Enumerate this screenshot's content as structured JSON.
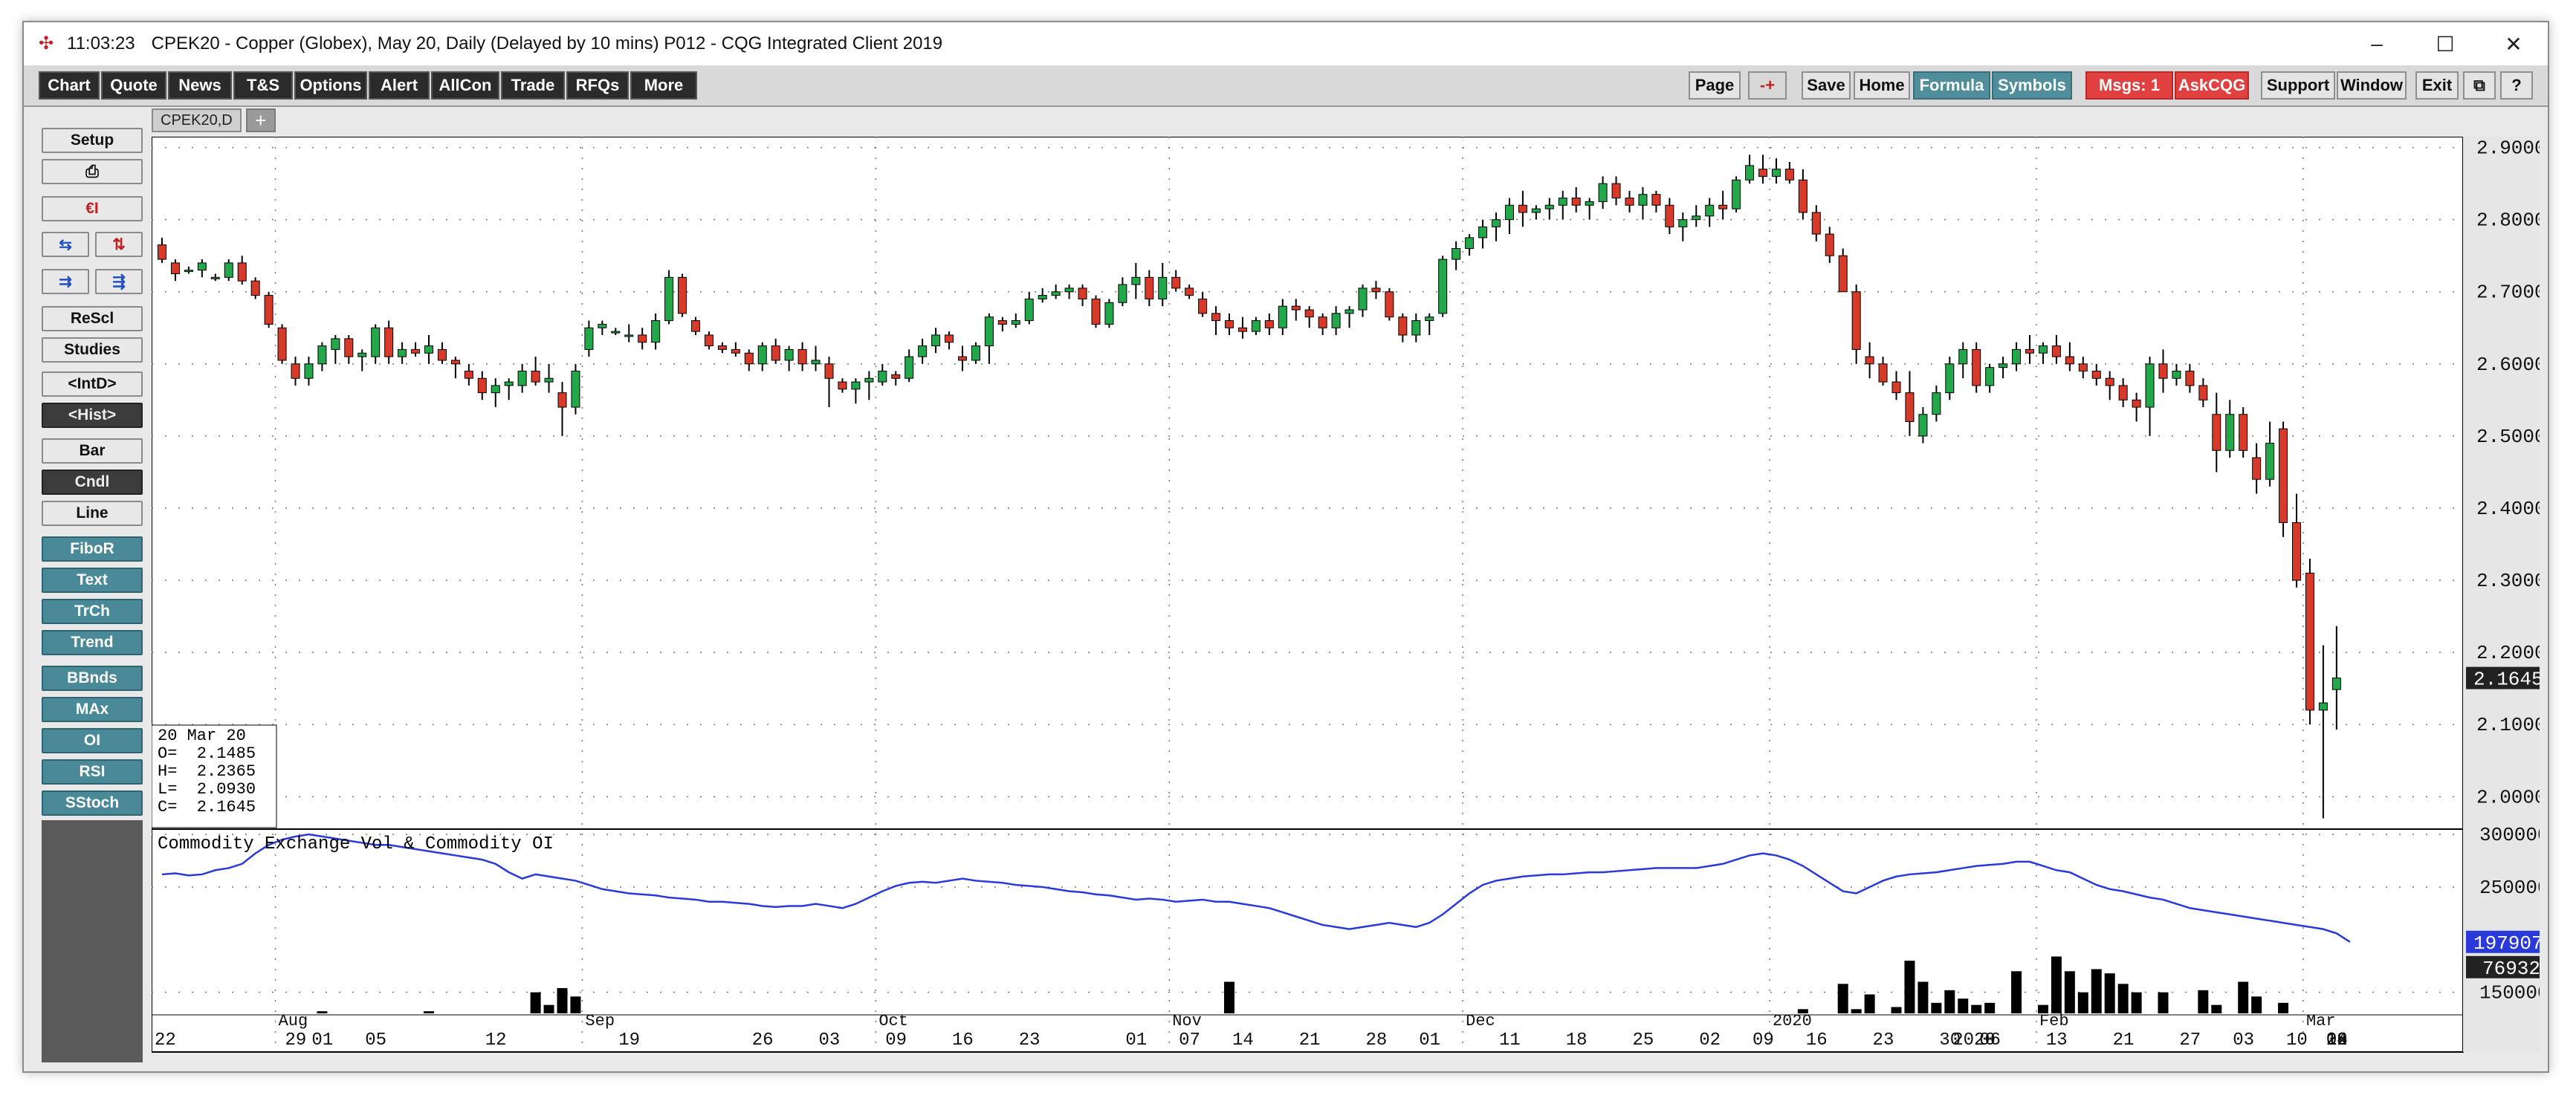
{
  "title_bar": {
    "time": "11:03:23",
    "title": "CPEK20 - Copper (Globex), May 20, Daily (Delayed by 10 mins)   P012 - CQG Integrated Client 2019",
    "minimize": "–",
    "maximize": "☐",
    "close": "✕"
  },
  "menu_left": [
    "Chart",
    "Quote",
    "News",
    "T&S",
    "Options",
    "Alert",
    "AllCon",
    "Trade",
    "RFQs",
    "More"
  ],
  "menu_right": {
    "page": "Page",
    "arrows": "-+",
    "save": "Save",
    "home": "Home",
    "formula": "Formula",
    "symbols": "Symbols",
    "msgs": "Msgs: 1",
    "askcqg": "AskCQG",
    "support": "Support",
    "window": "Window",
    "exit": "Exit",
    "restore": "⧉",
    "help": "?"
  },
  "sidebar": {
    "setup": "Setup",
    "print_icon": "⎙",
    "currency_icon": "€I",
    "rescl": "ReScl",
    "studies": "Studies",
    "intd": "<IntD>",
    "hist": "<Hist>",
    "bar": "Bar",
    "cndl": "Cndl",
    "line": "Line",
    "studies_list": [
      "FiboR",
      "Text",
      "TrCh",
      "Trend",
      "BBnds",
      "MAx",
      "OI",
      "RSI",
      "SStoch"
    ]
  },
  "tab": {
    "label": "CPEK20,D",
    "add": "+"
  },
  "chart_data": {
    "type": "candlestick",
    "symbol": "CPEK20,D",
    "price_axis": {
      "ylim": [
        1.955,
        2.915
      ],
      "ticks": [
        "2.9000",
        "2.8000",
        "2.7000",
        "2.6000",
        "2.5000",
        "2.4000",
        "2.3000",
        "2.2000",
        "2.1000",
        "2.0000"
      ],
      "current": "2.1645"
    },
    "date_labels": [
      "22",
      "29",
      "01",
      "05",
      "12",
      "19",
      "26",
      "03",
      "09",
      "16",
      "23",
      "01",
      "07",
      "14",
      "21",
      "28",
      "01",
      "11",
      "18",
      "25",
      "02",
      "09",
      "16",
      "23",
      "30",
      "2020",
      "06",
      "13",
      "21",
      "27",
      "03",
      "10",
      "18",
      "24",
      "02",
      "09",
      "16"
    ],
    "month_labels": [
      "Aug",
      "Sep",
      "Oct",
      "Nov",
      "Dec",
      "2020",
      "Feb",
      "Mar"
    ],
    "ohlc_readout": {
      "date": "20 Mar 20",
      "open": "O=  2.1485",
      "high": "H=  2.2365",
      "low": "L=  2.0930",
      "close": "C=  2.1645"
    },
    "candles": [
      [
        2.765,
        2.775,
        2.74,
        2.745
      ],
      [
        2.74,
        2.745,
        2.715,
        2.725
      ],
      [
        2.73,
        2.735,
        2.725,
        2.73
      ],
      [
        2.73,
        2.745,
        2.72,
        2.74
      ],
      [
        2.72,
        2.725,
        2.715,
        2.72
      ],
      [
        2.72,
        2.745,
        2.715,
        2.74
      ],
      [
        2.74,
        2.75,
        2.71,
        2.715
      ],
      [
        2.715,
        2.72,
        2.69,
        2.695
      ],
      [
        2.695,
        2.7,
        2.65,
        2.655
      ],
      [
        2.65,
        2.655,
        2.6,
        2.605
      ],
      [
        2.6,
        2.61,
        2.57,
        2.58
      ],
      [
        2.58,
        2.61,
        2.57,
        2.6
      ],
      [
        2.6,
        2.63,
        2.59,
        2.625
      ],
      [
        2.62,
        2.64,
        2.6,
        2.635
      ],
      [
        2.635,
        2.64,
        2.6,
        2.61
      ],
      [
        2.61,
        2.62,
        2.59,
        2.615
      ],
      [
        2.61,
        2.655,
        2.6,
        2.65
      ],
      [
        2.65,
        2.66,
        2.6,
        2.61
      ],
      [
        2.61,
        2.63,
        2.6,
        2.62
      ],
      [
        2.62,
        2.63,
        2.61,
        2.615
      ],
      [
        2.615,
        2.64,
        2.6,
        2.625
      ],
      [
        2.62,
        2.63,
        2.6,
        2.605
      ],
      [
        2.605,
        2.61,
        2.58,
        2.6
      ],
      [
        2.59,
        2.6,
        2.57,
        2.58
      ],
      [
        2.58,
        2.59,
        2.55,
        2.56
      ],
      [
        2.56,
        2.58,
        2.54,
        2.57
      ],
      [
        2.57,
        2.58,
        2.55,
        2.575
      ],
      [
        2.57,
        2.6,
        2.56,
        2.59
      ],
      [
        2.59,
        2.61,
        2.57,
        2.575
      ],
      [
        2.575,
        2.6,
        2.56,
        2.58
      ],
      [
        2.56,
        2.575,
        2.5,
        2.54
      ],
      [
        2.54,
        2.6,
        2.53,
        2.59
      ],
      [
        2.62,
        2.66,
        2.61,
        2.65
      ],
      [
        2.65,
        2.66,
        2.64,
        2.655
      ],
      [
        2.645,
        2.65,
        2.64,
        2.645
      ],
      [
        2.64,
        2.655,
        2.63,
        2.64
      ],
      [
        2.64,
        2.65,
        2.62,
        2.63
      ],
      [
        2.63,
        2.67,
        2.62,
        2.66
      ],
      [
        2.66,
        2.73,
        2.655,
        2.72
      ],
      [
        2.72,
        2.725,
        2.665,
        2.67
      ],
      [
        2.66,
        2.665,
        2.64,
        2.645
      ],
      [
        2.64,
        2.645,
        2.62,
        2.625
      ],
      [
        2.625,
        2.63,
        2.615,
        2.62
      ],
      [
        2.62,
        2.63,
        2.61,
        2.615
      ],
      [
        2.615,
        2.62,
        2.59,
        2.6
      ],
      [
        2.6,
        2.63,
        2.59,
        2.625
      ],
      [
        2.625,
        2.635,
        2.6,
        2.605
      ],
      [
        2.605,
        2.625,
        2.59,
        2.62
      ],
      [
        2.62,
        2.63,
        2.59,
        2.6
      ],
      [
        2.6,
        2.625,
        2.59,
        2.605
      ],
      [
        2.6,
        2.61,
        2.54,
        2.58
      ],
      [
        2.575,
        2.58,
        2.56,
        2.565
      ],
      [
        2.565,
        2.58,
        2.545,
        2.575
      ],
      [
        2.575,
        2.59,
        2.55,
        2.58
      ],
      [
        2.575,
        2.6,
        2.57,
        2.59
      ],
      [
        2.585,
        2.59,
        2.57,
        2.58
      ],
      [
        2.58,
        2.62,
        2.575,
        2.61
      ],
      [
        2.61,
        2.635,
        2.6,
        2.625
      ],
      [
        2.625,
        2.65,
        2.615,
        2.64
      ],
      [
        2.64,
        2.645,
        2.62,
        2.63
      ],
      [
        2.61,
        2.625,
        2.59,
        2.605
      ],
      [
        2.605,
        2.63,
        2.6,
        2.625
      ],
      [
        2.625,
        2.67,
        2.6,
        2.665
      ],
      [
        2.66,
        2.665,
        2.645,
        2.655
      ],
      [
        2.655,
        2.67,
        2.65,
        2.66
      ],
      [
        2.66,
        2.7,
        2.655,
        2.69
      ],
      [
        2.69,
        2.705,
        2.685,
        2.695
      ],
      [
        2.695,
        2.71,
        2.69,
        2.7
      ],
      [
        2.7,
        2.71,
        2.69,
        2.705
      ],
      [
        2.705,
        2.71,
        2.68,
        2.69
      ],
      [
        2.69,
        2.695,
        2.65,
        2.655
      ],
      [
        2.655,
        2.69,
        2.65,
        2.685
      ],
      [
        2.685,
        2.72,
        2.68,
        2.71
      ],
      [
        2.71,
        2.74,
        2.69,
        2.72
      ],
      [
        2.72,
        2.73,
        2.68,
        2.69
      ],
      [
        2.69,
        2.74,
        2.68,
        2.72
      ],
      [
        2.72,
        2.73,
        2.7,
        2.705
      ],
      [
        2.705,
        2.71,
        2.69,
        2.695
      ],
      [
        2.69,
        2.7,
        2.665,
        2.67
      ],
      [
        2.67,
        2.68,
        2.64,
        2.66
      ],
      [
        2.66,
        2.67,
        2.64,
        2.65
      ],
      [
        2.65,
        2.665,
        2.635,
        2.645
      ],
      [
        2.645,
        2.665,
        2.64,
        2.66
      ],
      [
        2.66,
        2.67,
        2.64,
        2.65
      ],
      [
        2.65,
        2.69,
        2.64,
        2.68
      ],
      [
        2.68,
        2.69,
        2.66,
        2.675
      ],
      [
        2.675,
        2.68,
        2.65,
        2.665
      ],
      [
        2.665,
        2.67,
        2.64,
        2.65
      ],
      [
        2.65,
        2.68,
        2.64,
        2.67
      ],
      [
        2.67,
        2.68,
        2.65,
        2.675
      ],
      [
        2.675,
        2.71,
        2.665,
        2.705
      ],
      [
        2.705,
        2.715,
        2.69,
        2.7
      ],
      [
        2.7,
        2.705,
        2.66,
        2.665
      ],
      [
        2.665,
        2.67,
        2.63,
        2.64
      ],
      [
        2.64,
        2.67,
        2.63,
        2.66
      ],
      [
        2.66,
        2.67,
        2.64,
        2.665
      ],
      [
        2.67,
        2.75,
        2.665,
        2.745
      ],
      [
        2.745,
        2.77,
        2.73,
        2.76
      ],
      [
        2.76,
        2.78,
        2.75,
        2.775
      ],
      [
        2.775,
        2.8,
        2.76,
        2.79
      ],
      [
        2.79,
        2.81,
        2.77,
        2.8
      ],
      [
        2.8,
        2.83,
        2.78,
        2.82
      ],
      [
        2.82,
        2.84,
        2.79,
        2.81
      ],
      [
        2.81,
        2.82,
        2.8,
        2.815
      ],
      [
        2.815,
        2.83,
        2.8,
        2.82
      ],
      [
        2.82,
        2.84,
        2.8,
        2.83
      ],
      [
        2.83,
        2.845,
        2.81,
        2.82
      ],
      [
        2.82,
        2.83,
        2.8,
        2.825
      ],
      [
        2.825,
        2.86,
        2.815,
        2.85
      ],
      [
        2.85,
        2.86,
        2.82,
        2.83
      ],
      [
        2.83,
        2.84,
        2.81,
        2.82
      ],
      [
        2.82,
        2.845,
        2.8,
        2.835
      ],
      [
        2.835,
        2.84,
        2.81,
        2.82
      ],
      [
        2.82,
        2.83,
        2.78,
        2.79
      ],
      [
        2.79,
        2.81,
        2.77,
        2.8
      ],
      [
        2.8,
        2.82,
        2.79,
        2.805
      ],
      [
        2.805,
        2.83,
        2.79,
        2.82
      ],
      [
        2.82,
        2.84,
        2.8,
        2.815
      ],
      [
        2.815,
        2.86,
        2.81,
        2.855
      ],
      [
        2.855,
        2.89,
        2.85,
        2.875
      ],
      [
        2.87,
        2.89,
        2.85,
        2.86
      ],
      [
        2.86,
        2.885,
        2.85,
        2.87
      ],
      [
        2.87,
        2.88,
        2.85,
        2.855
      ],
      [
        2.855,
        2.87,
        2.8,
        2.81
      ],
      [
        2.81,
        2.82,
        2.77,
        2.78
      ],
      [
        2.78,
        2.79,
        2.74,
        2.75
      ],
      [
        2.75,
        2.76,
        2.7,
        2.7
      ],
      [
        2.7,
        2.71,
        2.6,
        2.62
      ],
      [
        2.61,
        2.63,
        2.58,
        2.6
      ],
      [
        2.6,
        2.61,
        2.57,
        2.575
      ],
      [
        2.575,
        2.59,
        2.55,
        2.56
      ],
      [
        2.56,
        2.59,
        2.5,
        2.52
      ],
      [
        2.5,
        2.54,
        2.49,
        2.53
      ],
      [
        2.53,
        2.57,
        2.52,
        2.56
      ],
      [
        2.56,
        2.61,
        2.55,
        2.6
      ],
      [
        2.6,
        2.63,
        2.58,
        2.62
      ],
      [
        2.62,
        2.63,
        2.56,
        2.57
      ],
      [
        2.57,
        2.6,
        2.56,
        2.595
      ],
      [
        2.595,
        2.61,
        2.58,
        2.6
      ],
      [
        2.6,
        2.63,
        2.59,
        2.62
      ],
      [
        2.62,
        2.64,
        2.6,
        2.615
      ],
      [
        2.615,
        2.63,
        2.6,
        2.625
      ],
      [
        2.625,
        2.64,
        2.6,
        2.61
      ],
      [
        2.61,
        2.63,
        2.59,
        2.6
      ],
      [
        2.6,
        2.61,
        2.58,
        2.59
      ],
      [
        2.59,
        2.6,
        2.57,
        2.58
      ],
      [
        2.58,
        2.59,
        2.55,
        2.57
      ],
      [
        2.57,
        2.58,
        2.54,
        2.55
      ],
      [
        2.55,
        2.56,
        2.52,
        2.54
      ],
      [
        2.54,
        2.61,
        2.5,
        2.6
      ],
      [
        2.6,
        2.62,
        2.56,
        2.58
      ],
      [
        2.58,
        2.6,
        2.57,
        2.59
      ],
      [
        2.59,
        2.6,
        2.56,
        2.57
      ],
      [
        2.57,
        2.58,
        2.54,
        2.55
      ],
      [
        2.53,
        2.56,
        2.45,
        2.48
      ],
      [
        2.48,
        2.55,
        2.47,
        2.53
      ],
      [
        2.53,
        2.54,
        2.47,
        2.48
      ],
      [
        2.47,
        2.49,
        2.42,
        2.44
      ],
      [
        2.44,
        2.52,
        2.43,
        2.49
      ],
      [
        2.51,
        2.52,
        2.36,
        2.38
      ],
      [
        2.38,
        2.42,
        2.29,
        2.3
      ],
      [
        2.31,
        2.33,
        2.1,
        2.12
      ],
      [
        2.12,
        2.21,
        1.97,
        2.13
      ],
      [
        2.1485,
        2.2365,
        2.093,
        2.1645
      ]
    ],
    "volume_panel": {
      "title": "Commodity Exchange Vol & Commodity OI",
      "ylim": [
        130000,
        305000
      ],
      "ticks": [
        "300000",
        "250000",
        "150000"
      ],
      "current_oi": "197907",
      "current_vol": "76932",
      "volume": [
        90000,
        82000,
        74000,
        88000,
        86000,
        80000,
        92000,
        98000,
        108000,
        118000,
        110000,
        100000,
        132000,
        128000,
        118000,
        110000,
        128000,
        120000,
        100000,
        105000,
        132000,
        112000,
        96000,
        70000,
        86000,
        90000,
        118000,
        130000,
        150000,
        138000,
        154000,
        146000,
        90000,
        112000,
        130000,
        100000,
        90000,
        98000,
        80000,
        92000,
        120000,
        96000,
        88000,
        72000,
        62000,
        56000,
        66000,
        70000,
        64000,
        66000,
        64000,
        58000,
        72000,
        94000,
        68000,
        58000,
        72000,
        70000,
        54000,
        70000,
        90000,
        88000,
        70000,
        62000,
        76000,
        64000,
        64000,
        72000,
        78000,
        62000,
        58000,
        56000,
        64000,
        72000,
        74000,
        82000,
        110000,
        80000,
        108000,
        98000,
        160000,
        120000,
        112000,
        86000,
        114000,
        104000,
        92000,
        128000,
        118000,
        124000,
        112000,
        106000,
        120000,
        108000,
        90000,
        86000,
        76000,
        100000,
        86000,
        118000,
        108000,
        98000,
        118000,
        130000,
        90000,
        86000,
        74000,
        78000,
        66000,
        62000,
        58000,
        54000,
        60000,
        74000,
        94000,
        84000,
        72000,
        90000,
        100000,
        110000,
        126000,
        106000,
        118000,
        134000,
        128000,
        112000,
        158000,
        134000,
        148000,
        130000,
        136000,
        180000,
        160000,
        140000,
        152000,
        144000,
        138000,
        140000,
        130000,
        170000,
        130000,
        138000,
        184000,
        170000,
        150000,
        172000,
        168000,
        158000,
        150000,
        112000,
        150000,
        86000,
        104000,
        152000,
        138000,
        128000,
        160000,
        146000,
        120000,
        140000,
        130000,
        114000,
        116000,
        100000,
        76932
      ],
      "open_interest": [
        262000,
        263000,
        261000,
        262000,
        266000,
        268000,
        272000,
        282000,
        290000,
        295000,
        298000,
        300000,
        298000,
        296000,
        294000,
        292000,
        290000,
        290000,
        288000,
        286000,
        284000,
        282000,
        280000,
        278000,
        276000,
        272000,
        264000,
        258000,
        262000,
        260000,
        258000,
        256000,
        252000,
        248000,
        246000,
        244000,
        243000,
        242000,
        240000,
        239000,
        238000,
        236000,
        236000,
        235000,
        234000,
        232000,
        231000,
        232000,
        232000,
        234000,
        232000,
        230000,
        234000,
        240000,
        246000,
        251000,
        254000,
        255000,
        254000,
        256000,
        258000,
        256000,
        255000,
        254000,
        252000,
        251000,
        250000,
        248000,
        246000,
        245000,
        243000,
        242000,
        240000,
        238000,
        239000,
        238000,
        236000,
        237000,
        238000,
        236000,
        236000,
        234000,
        232000,
        230000,
        226000,
        222000,
        218000,
        214000,
        212000,
        210000,
        212000,
        214000,
        216000,
        214000,
        212000,
        216000,
        224000,
        234000,
        244000,
        252000,
        256000,
        258000,
        260000,
        261000,
        262000,
        262000,
        263000,
        264000,
        264000,
        265000,
        266000,
        267000,
        268000,
        268000,
        268000,
        268000,
        270000,
        272000,
        276000,
        280000,
        282000,
        280000,
        276000,
        270000,
        262000,
        254000,
        246000,
        244000,
        250000,
        256000,
        260000,
        262000,
        263000,
        264000,
        266000,
        268000,
        270000,
        271000,
        272000,
        274000,
        274000,
        270000,
        266000,
        264000,
        258000,
        252000,
        248000,
        246000,
        243000,
        240000,
        238000,
        234000,
        230000,
        228000,
        226000,
        224000,
        222000,
        220000,
        218000,
        216000,
        214000,
        212000,
        210000,
        206000,
        197907
      ]
    }
  }
}
